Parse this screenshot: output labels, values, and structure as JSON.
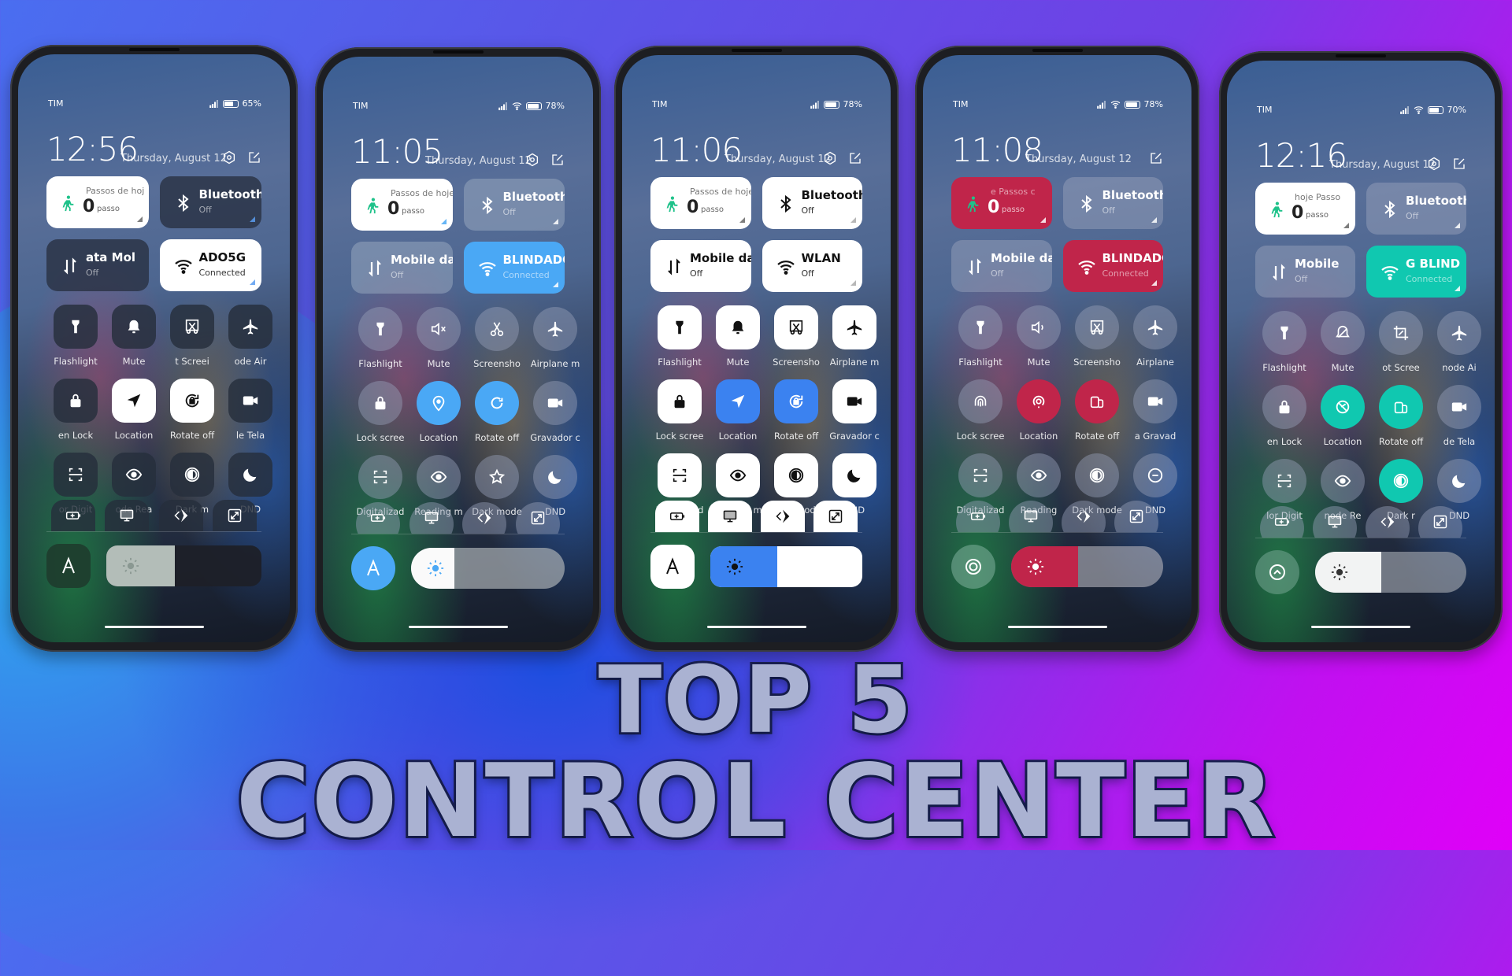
{
  "title": {
    "line1": "TOP 5",
    "line2": "CONTROL CENTER"
  },
  "phones": [
    {
      "theme": "dark-square",
      "accent": "#ffffff",
      "carrier": "TIM",
      "battery": "65%",
      "battery_level": 0.65,
      "time": "12:56",
      "date": "Thursday, August 12",
      "header_icons": [
        "settings-icon",
        "edit-icon"
      ],
      "steps": {
        "label": "Passos de hoj",
        "value": "0",
        "unit": "passo"
      },
      "bluetooth": {
        "label": "Bluetooth",
        "status": "Off"
      },
      "mobile_data": {
        "label": "ata      Mol",
        "status": "Off"
      },
      "wifi": {
        "label": "ADO5G",
        "status": "Connected"
      },
      "toggles": [
        {
          "label": "Flashlight",
          "icon": "flashlight-icon",
          "active": false
        },
        {
          "label": "Mute",
          "icon": "bell-icon",
          "active": false
        },
        {
          "label": "t    Screei",
          "icon": "screenshot-icon",
          "active": false
        },
        {
          "label": "ode    Air",
          "icon": "airplane-icon",
          "active": false
        },
        {
          "label": "en    Lock",
          "icon": "lock-icon",
          "active": false
        },
        {
          "label": "Location",
          "icon": "location-icon",
          "active": true
        },
        {
          "label": "Rotate off",
          "icon": "rotate-lock-icon",
          "active": true
        },
        {
          "label": "le Tela",
          "icon": "video-icon",
          "active": false
        },
        {
          "label": "or   Digit",
          "icon": "scan-icon",
          "active": false
        },
        {
          "label": "ode   Rea",
          "icon": "eye-icon",
          "active": false
        },
        {
          "label": "Dark m",
          "icon": "dark-mode-icon",
          "active": false
        },
        {
          "label": "DND",
          "icon": "moon-icon",
          "active": false
        }
      ],
      "row3_icons": [
        "battery-saver-icon",
        "cast-icon",
        "direction-icon",
        "expand-icon"
      ],
      "auto_brightness": {
        "label": "A",
        "active": false
      },
      "brightness": 0.44
    },
    {
      "theme": "round-blue",
      "accent": "#4aa8f5",
      "carrier": "TIM",
      "battery": "78%",
      "battery_level": 0.78,
      "time": "11:05",
      "date": "Thursday, August 12",
      "header_icons": [
        "settings-icon",
        "edit-icon"
      ],
      "steps": {
        "label": "Passos de hoje",
        "value": "0",
        "unit": "passo"
      },
      "bluetooth": {
        "label": "Bluetooth",
        "status": "Off"
      },
      "mobile_data": {
        "label": "Mobile dat",
        "status": "Off"
      },
      "wifi": {
        "label": "BLINDADC",
        "status": "Connected"
      },
      "toggles": [
        {
          "label": "Flashlight",
          "icon": "flashlight-icon",
          "active": false
        },
        {
          "label": "Mute",
          "icon": "mute-icon",
          "active": false
        },
        {
          "label": "Screensho",
          "icon": "scissors-icon",
          "active": false
        },
        {
          "label": "Airplane m",
          "icon": "airplane-icon",
          "active": false
        },
        {
          "label": "Lock scree",
          "icon": "lock-icon",
          "active": false
        },
        {
          "label": "Location",
          "icon": "location-pin-icon",
          "active": true
        },
        {
          "label": "Rotate off",
          "icon": "rotate-icon",
          "active": true
        },
        {
          "label": "Gravador c",
          "icon": "video-icon",
          "active": false
        },
        {
          "label": "Digitalizad",
          "icon": "scan-icon",
          "active": false
        },
        {
          "label": "Reading m",
          "icon": "eye-icon",
          "active": false
        },
        {
          "label": "Dark mode",
          "icon": "star-icon",
          "active": false
        },
        {
          "label": "DND",
          "icon": "moon-icon",
          "active": false
        }
      ],
      "row3_icons": [
        "battery-saver-icon",
        "cast-icon",
        "direction-icon",
        "expand-icon"
      ],
      "auto_brightness": {
        "label": "A",
        "active": true
      },
      "brightness": 0.28
    },
    {
      "theme": "white-square",
      "accent": "#3b82f0",
      "carrier": "TIM",
      "battery": "78%",
      "battery_level": 0.78,
      "time": "11:06",
      "date": "Thursday, August 12",
      "header_icons": [
        "settings-icon",
        "edit-icon"
      ],
      "steps": {
        "label": "Passos de hoje",
        "value": "0",
        "unit": "passo"
      },
      "bluetooth": {
        "label": "Bluetooth",
        "status": "Off"
      },
      "mobile_data": {
        "label": "Mobile dat",
        "status": "Off"
      },
      "wifi": {
        "label": "WLAN",
        "status": "Off"
      },
      "toggles": [
        {
          "label": "Flashlight",
          "icon": "flashlight-icon",
          "active": false
        },
        {
          "label": "Mute",
          "icon": "bell-icon",
          "active": false
        },
        {
          "label": "Screensho",
          "icon": "screenshot-icon",
          "active": false
        },
        {
          "label": "Airplane m",
          "icon": "airplane-icon",
          "active": false
        },
        {
          "label": "Lock scree",
          "icon": "lock-icon",
          "active": false
        },
        {
          "label": "Location",
          "icon": "location-icon",
          "active": true
        },
        {
          "label": "Rotate off",
          "icon": "rotate-lock-icon",
          "active": true
        },
        {
          "label": "Gravador c",
          "icon": "video-icon",
          "active": false
        },
        {
          "label": "Digitalizad",
          "icon": "scan-icon",
          "active": false
        },
        {
          "label": "Reading m",
          "icon": "eye-icon",
          "active": false
        },
        {
          "label": "Dark mode",
          "icon": "dark-mode-icon",
          "active": false
        },
        {
          "label": "DND",
          "icon": "moon-icon",
          "active": false
        }
      ],
      "row3_icons": [
        "battery-saver-icon",
        "cast-icon",
        "direction-icon",
        "expand-icon"
      ],
      "auto_brightness": {
        "label": "A",
        "active": false
      },
      "brightness": 0.44
    },
    {
      "theme": "round-red",
      "accent": "#c0254a",
      "carrier": "TIM",
      "battery": "78%",
      "battery_level": 0.78,
      "time": "11:08",
      "date": "Thursday, August 12",
      "header_icons": [
        "edit-icon"
      ],
      "steps": {
        "label": "e      Passos c",
        "value": "0",
        "unit": "passo"
      },
      "bluetooth": {
        "label": "Bluetooth",
        "status": "Off"
      },
      "mobile_data": {
        "label": "Mobile dat",
        "status": "Off"
      },
      "wifi": {
        "label": "BLINDADC",
        "status": "Connected"
      },
      "toggles": [
        {
          "label": "Flashlight",
          "icon": "flashlight-icon",
          "active": false
        },
        {
          "label": "Mute",
          "icon": "speaker-icon",
          "active": false
        },
        {
          "label": "Screensho",
          "icon": "screenshot-icon",
          "active": false
        },
        {
          "label": "Airplane",
          "icon": "airplane-icon",
          "active": false
        },
        {
          "label": "Lock scree",
          "icon": "fingerprint-icon",
          "active": false
        },
        {
          "label": "Location",
          "icon": "location-ring-icon",
          "active": true
        },
        {
          "label": "Rotate off",
          "icon": "rotate-device-icon",
          "active": true
        },
        {
          "label": "a    Gravad",
          "icon": "video-icon",
          "active": false
        },
        {
          "label": "Digitalizad",
          "icon": "scan-icon",
          "active": false
        },
        {
          "label": "Reading",
          "icon": "eye-icon",
          "active": false
        },
        {
          "label": "Dark mode",
          "icon": "dark-mode-icon",
          "active": false
        },
        {
          "label": "DND",
          "icon": "minus-circle-icon",
          "active": false
        }
      ],
      "row3_icons": [
        "battery-saver-icon",
        "cast-icon",
        "direction-icon",
        "expand-icon"
      ],
      "auto_brightness": {
        "label": "",
        "active": false
      },
      "brightness": 0.44
    },
    {
      "theme": "round-teal",
      "accent": "#10c8b0",
      "carrier": "TIM",
      "battery": "70%",
      "battery_level": 0.7,
      "time": "12:16",
      "date": "Thursday, August 12",
      "header_icons": [
        "settings-icon",
        "edit-icon"
      ],
      "steps": {
        "label": "hoje      Passo",
        "value": "0",
        "unit": "passo"
      },
      "bluetooth": {
        "label": "Bluetooth",
        "status": "Off"
      },
      "mobile_data": {
        "label": "Mobile",
        "status": "Off"
      },
      "wifi": {
        "label": "G    BLIND",
        "status": "Connected"
      },
      "toggles": [
        {
          "label": "Flashlight",
          "icon": "flashlight-icon",
          "active": false
        },
        {
          "label": "Mute",
          "icon": "bell-off-icon",
          "active": false
        },
        {
          "label": "ot   Scree",
          "icon": "crop-icon",
          "active": false
        },
        {
          "label": "node    Ai",
          "icon": "airplane-icon",
          "active": false
        },
        {
          "label": "en    Lock",
          "icon": "lock-icon",
          "active": false
        },
        {
          "label": "Location",
          "icon": "location-off-icon",
          "active": true
        },
        {
          "label": "Rotate off",
          "icon": "rotate-device-icon",
          "active": true
        },
        {
          "label": "de Tela",
          "icon": "video-icon",
          "active": false
        },
        {
          "label": "lor   Digit",
          "icon": "scan-icon",
          "active": false
        },
        {
          "label": "node   Re",
          "icon": "eye-icon",
          "active": false
        },
        {
          "label": "Dark r",
          "icon": "dark-mode-icon",
          "active": true
        },
        {
          "label": "DND",
          "icon": "moon-icon",
          "active": false
        }
      ],
      "row3_icons": [
        "battery-saver-icon",
        "cast-icon",
        "direction-icon",
        "expand-icon"
      ],
      "auto_brightness": {
        "label": "",
        "active": false
      },
      "brightness": 0.44
    }
  ]
}
